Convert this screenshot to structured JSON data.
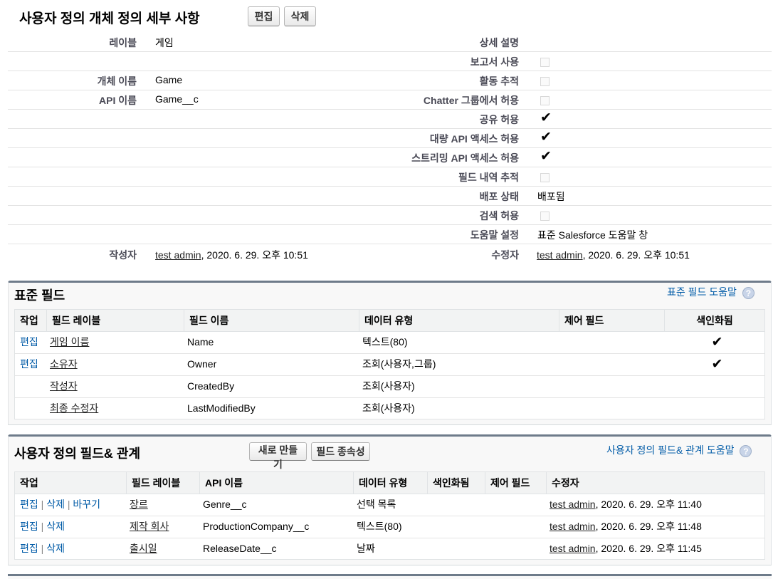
{
  "detail": {
    "title": "사용자 정의 개체 정의 세부 사항",
    "edit_button": "편집",
    "delete_button": "삭제",
    "left": {
      "label_label": "레이블",
      "label_value": "게임",
      "object_name_label": "개체 이름",
      "object_name_value": "Game",
      "api_name_label": "API 이름",
      "api_name_value": "Game__c",
      "created_by_label": "작성자",
      "created_by_user": "test admin",
      "created_by_date": ", 2020. 6. 29. 오후 10:51"
    },
    "right": {
      "description_label": "상세 설명",
      "allow_reports_label": "보고서 사용",
      "track_activities_label": "활동 추적",
      "allow_chatter_label": "Chatter 그룹에서 허용",
      "allow_sharing_label": "공유 허용",
      "bulk_api_label": "대량 API 액세스 허용",
      "streaming_api_label": "스트리밍 API 액세스 허용",
      "field_history_label": "필드 내역 추적",
      "deployment_status_label": "배포 상태",
      "deployment_status_value": "배포됨",
      "allow_search_label": "검색 허용",
      "help_setting_label": "도움말 설정",
      "help_setting_value": "표준 Salesforce 도움말 창",
      "modified_by_label": "수정자",
      "modified_by_user": "test admin",
      "modified_by_date": ", 2020. 6. 29. 오후 10:51"
    },
    "checkboxes": {
      "allow_reports": false,
      "track_activities": false,
      "allow_chatter": false,
      "allow_sharing": true,
      "bulk_api": true,
      "streaming_api": true,
      "field_history": false,
      "allow_search": false
    }
  },
  "standard_fields": {
    "title": "표준 필드",
    "help_link": "표준 필드 도움말",
    "columns": [
      "작업",
      "필드 레이블",
      "필드 이름",
      "데이터 유형",
      "제어 필드",
      "색인화됨"
    ],
    "rows": [
      {
        "action": "편집",
        "label": "게임 이름",
        "name": "Name",
        "type": "텍스트(80)",
        "controlling": "",
        "indexed": true
      },
      {
        "action": "편집",
        "label": "소유자",
        "name": "Owner",
        "type": "조회(사용자,그룹)",
        "controlling": "",
        "indexed": true
      },
      {
        "action": "",
        "label": "작성자",
        "name": "CreatedBy",
        "type": "조회(사용자)",
        "controlling": "",
        "indexed": false
      },
      {
        "action": "",
        "label": "최종 수정자",
        "name": "LastModifiedBy",
        "type": "조회(사용자)",
        "controlling": "",
        "indexed": false
      }
    ]
  },
  "custom_fields": {
    "title": "사용자 정의 필드& 관계",
    "new_button": "새로 만들기",
    "dependency_button": "필드 종속성",
    "help_link": "사용자 정의 필드& 관계 도움말",
    "columns": [
      "작업",
      "필드 레이블",
      "API 이름",
      "데이터 유형",
      "색인화됨",
      "제어 필드",
      "수정자"
    ],
    "rows": [
      {
        "edit": "편집",
        "del": "삭제",
        "replace": "바꾸기",
        "label": "장르",
        "api": "Genre__c",
        "type": "선택 목록",
        "user": "test admin",
        "date": ", 2020. 6. 29. 오후 11:40"
      },
      {
        "edit": "편집",
        "del": "삭제",
        "replace": "",
        "label": "제작 회사",
        "api": "ProductionCompany__c",
        "type": "텍스트(80)",
        "user": "test admin",
        "date": ", 2020. 6. 29. 오후 11:48"
      },
      {
        "edit": "편집",
        "del": "삭제",
        "replace": "",
        "label": "출시일",
        "api": "ReleaseDate__c",
        "type": "날짜",
        "user": "test admin",
        "date": ", 2020. 6. 29. 오후 11:45"
      }
    ],
    "separator": "|"
  },
  "help_icon_glyph": "?"
}
